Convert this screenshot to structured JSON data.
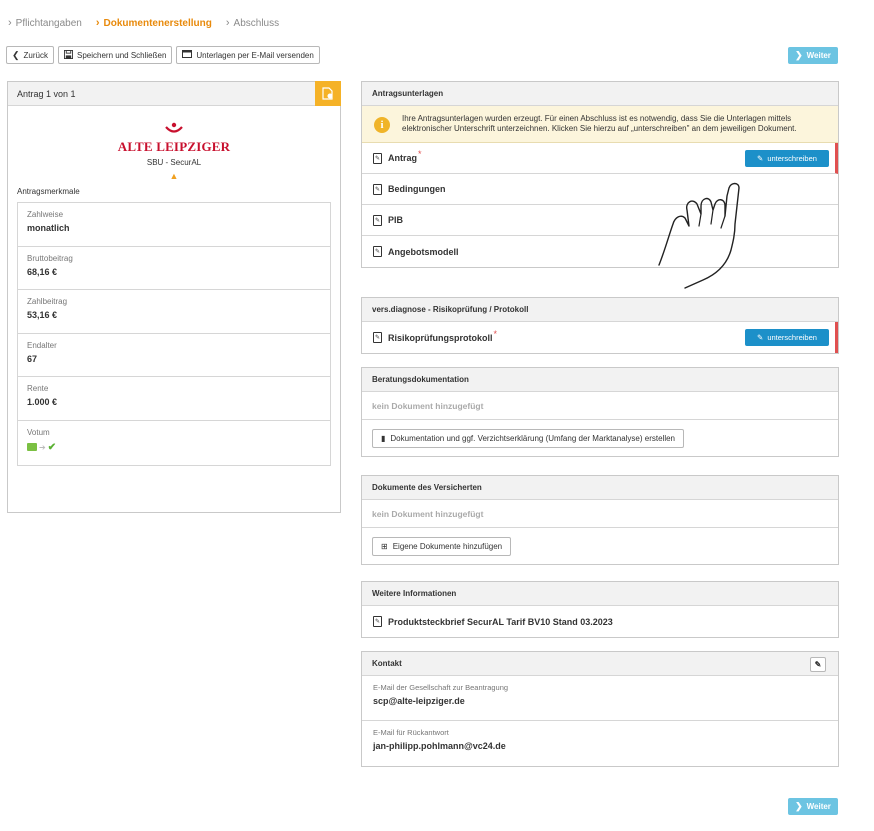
{
  "stepper": [
    {
      "label": "Pflichtangaben",
      "active": false
    },
    {
      "label": "Dokumentenerstellung",
      "active": true
    },
    {
      "label": "Abschluss",
      "active": false
    }
  ],
  "toolbar": {
    "back_label": "Zurück",
    "save_label": "Speichern und Schließen",
    "email_label": "Unterlagen per E-Mail versenden"
  },
  "next_label": "Weiter",
  "left": {
    "header": "Antrag 1 von 1",
    "brand": "ALTE LEIPZIGER",
    "product": "SBU - SecurAL",
    "section_label": "Antragsmerkmale",
    "merkmale": [
      {
        "label": "Zahlweise",
        "value": "monatlich"
      },
      {
        "label": "Bruttobeitrag",
        "value": "68,16 €"
      },
      {
        "label": "Zahlbeitrag",
        "value": "53,16 €"
      },
      {
        "label": "Endalter",
        "value": "67"
      },
      {
        "label": "Rente",
        "value": "1.000 €"
      },
      {
        "label": "Votum",
        "value": ""
      }
    ]
  },
  "antragsunterlagen": {
    "title": "Antragsunterlagen",
    "info": "Ihre Antragsunterlagen wurden erzeugt. Für einen Abschluss ist es notwendig, dass Sie die Unterlagen mittels elektronischer Unterschrift unterzeichnen. Klicken Sie hierzu auf „unterschreiben\" an dem jeweiligen Dokument.",
    "docs": [
      {
        "name": "Antrag",
        "required": true
      },
      {
        "name": "Bedingungen",
        "required": false
      },
      {
        "name": "PIB",
        "required": false
      },
      {
        "name": "Angebotsmodell",
        "required": false
      }
    ],
    "sign_label": "unterschreiben"
  },
  "versdiagnose": {
    "title": "vers.diagnose - Risikoprüfung / Protokoll",
    "doc": "Risikoprüfungsprotokoll",
    "sign_label": "unterschreiben"
  },
  "beratung": {
    "title": "Beratungsdokumentation",
    "empty": "kein Dokument hinzugefügt",
    "button": "Dokumentation und ggf. Verzichtserklärung (Umfang der Marktanalyse) erstellen"
  },
  "versicherte": {
    "title": "Dokumente des Versicherten",
    "empty": "kein Dokument hinzugefügt",
    "button": "Eigene Dokumente hinzufügen"
  },
  "weitere": {
    "title": "Weitere Informationen",
    "doc": "Produktsteckbrief SecurAL Tarif BV10 Stand 03.2023"
  },
  "kontakt": {
    "title": "Kontakt",
    "items": [
      {
        "label": "E-Mail der Gesellschaft zur Beantragung",
        "value": "scp@alte-leipziger.de"
      },
      {
        "label": "E-Mail für Rückantwort",
        "value": "jan-philipp.pohlmann@vc24.de"
      }
    ]
  },
  "colors": {
    "accent_orange": "#e88a0c",
    "primary_blue": "#1c90c9",
    "next_blue": "#6cc4e2",
    "brand_red": "#c8102e",
    "required_red": "#e05050"
  }
}
